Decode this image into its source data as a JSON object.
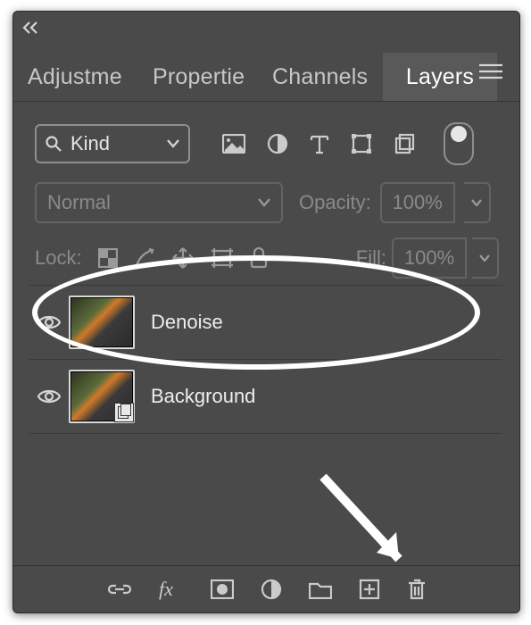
{
  "tabs": [
    "Adjustme",
    "Propertie",
    "Channels",
    "Layers"
  ],
  "filter": {
    "kind": "Kind"
  },
  "blend": {
    "mode": "Normal",
    "opacity_label": "Opacity:",
    "opacity_value": "100%"
  },
  "lock": {
    "label": "Lock:",
    "fill_label": "Fill:",
    "fill_value": "100%"
  },
  "layers": [
    {
      "name": "Denoise",
      "visible": true,
      "smart_object": false
    },
    {
      "name": "Background",
      "visible": true,
      "smart_object": true
    }
  ],
  "bottom_icons": [
    "link",
    "fx",
    "mask",
    "adjustment",
    "group",
    "new-layer",
    "delete"
  ]
}
